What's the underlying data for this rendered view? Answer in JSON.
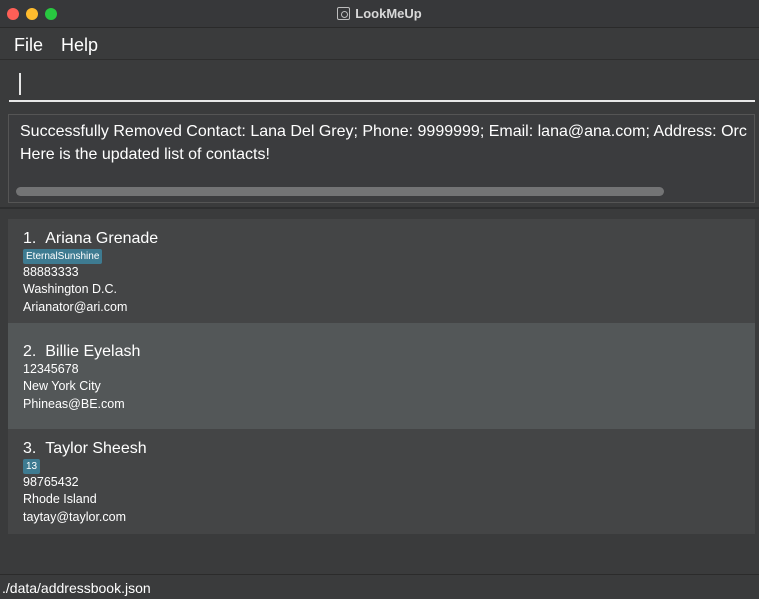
{
  "window": {
    "title": "LookMeUp"
  },
  "menu": {
    "file": "File",
    "help": "Help"
  },
  "command": {
    "value": ""
  },
  "result": {
    "line1": "Successfully Removed Contact: Lana Del Grey; Phone: 9999999; Email: lana@ana.com; Address: Orc",
    "line2": "Here is the updated list of contacts!"
  },
  "contacts": [
    {
      "index": "1.",
      "name": "Ariana Grenade",
      "tag": "EternalSunshine",
      "phone": "88883333",
      "address": "Washington D.C.",
      "email": "Arianator@ari.com"
    },
    {
      "index": "2.",
      "name": "Billie Eyelash",
      "phone": "12345678",
      "address": "New York City",
      "email": "Phineas@BE.com"
    },
    {
      "index": "3.",
      "name": "Taylor Sheesh",
      "tag": "13",
      "phone": "98765432",
      "address": "Rhode Island",
      "email": "taytay@taylor.com"
    }
  ],
  "status": {
    "path": "./data/addressbook.json"
  },
  "colors": {
    "tag": "#3e7b91",
    "selected_card": "#535758",
    "card": "#444546",
    "background": "#3a3b3c"
  }
}
